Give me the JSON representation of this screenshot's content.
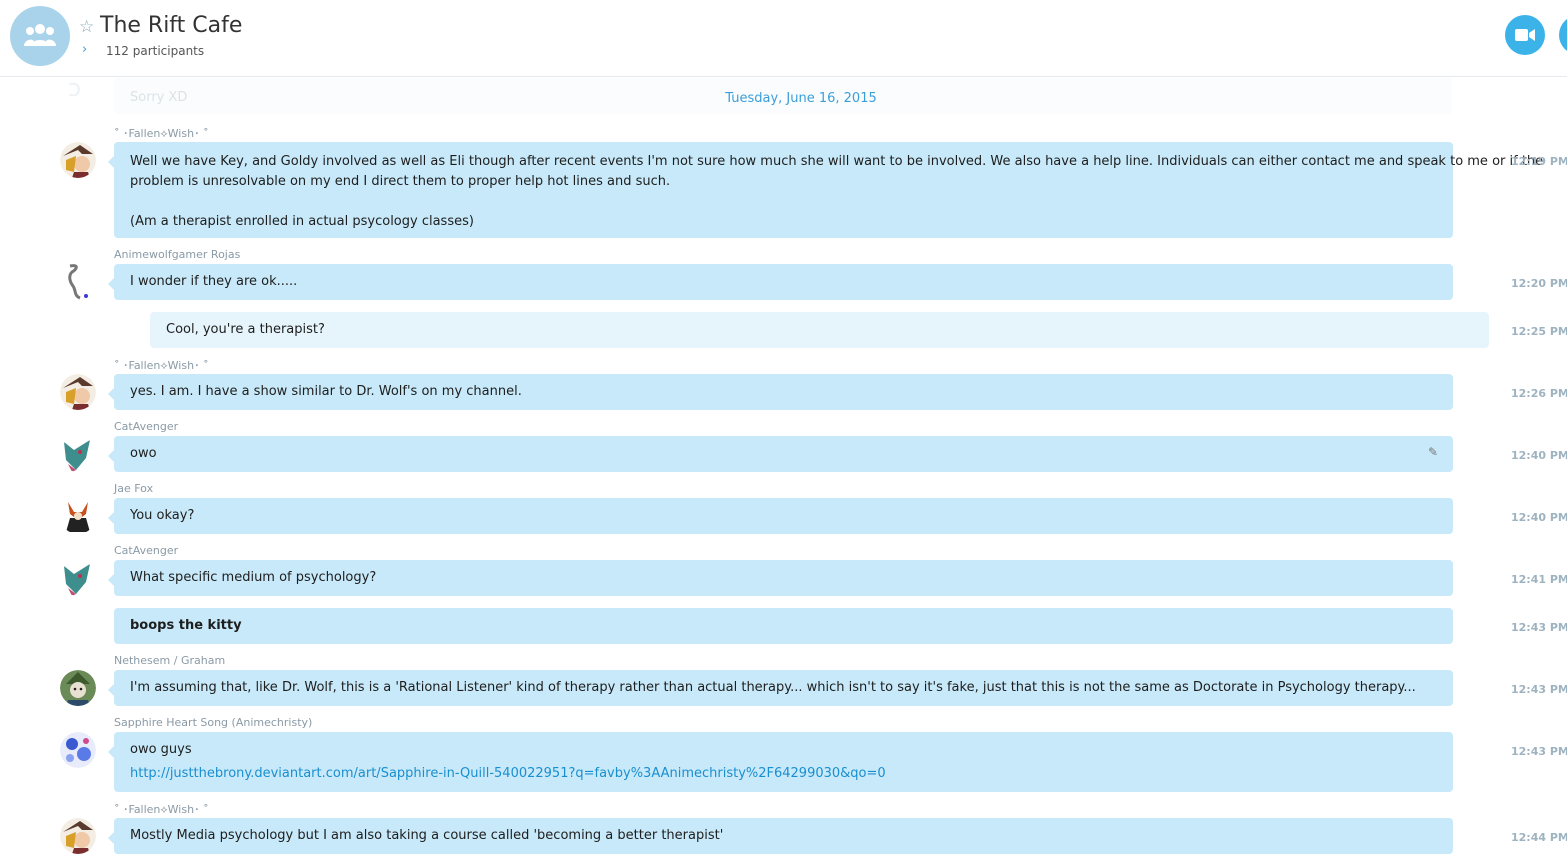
{
  "header": {
    "title": "The Rift Cafe",
    "participants": "112 participants",
    "star_glyph": "☆",
    "chevron_glyph": "›"
  },
  "faded_previous": "Sorry XD",
  "date_separator": "Tuesday, June 16, 2015",
  "messages": [
    {
      "sender": "˚ ･Fallen⟡Wish･ ˚",
      "lines": [
        "Well we have Key, and Goldy involved as well as Eli though after recent events I'm not sure how much she will want to be involved. We also have a help line. Individuals can either contact me and speak to me or if the",
        "problem is unresolvable on my end I direct them to proper help hot lines and such.",
        "",
        "(Am a therapist enrolled in actual psycology classes)"
      ],
      "time": "12:19 PM"
    },
    {
      "sender": "Animewolfgamer Rojas",
      "lines": [
        "I wonder if they are ok....."
      ],
      "time": "12:20 PM"
    },
    {
      "sender": "",
      "lines": [
        "Cool, you're a therapist?"
      ],
      "time": "12:25 PM"
    },
    {
      "sender": "˚ ･Fallen⟡Wish･ ˚",
      "lines": [
        "yes. I am. I have a show similar to Dr. Wolf's on my channel."
      ],
      "time": "12:26 PM"
    },
    {
      "sender": "CatAvenger",
      "lines": [
        "owo"
      ],
      "time": "12:40 PM"
    },
    {
      "sender": "Jae Fox",
      "lines": [
        "You okay?"
      ],
      "time": "12:40 PM"
    },
    {
      "sender": "CatAvenger",
      "lines": [
        "What specific medium of psychology?"
      ],
      "time": "12:41 PM"
    },
    {
      "sender": "",
      "lines": [
        "boops the kitty"
      ],
      "time": "12:43 PM"
    },
    {
      "sender": "Nethesem / Graham",
      "lines": [
        "I'm assuming that, like Dr. Wolf, this is a 'Rational Listener' kind of therapy rather than actual therapy... which isn't to say it's fake, just that this is not the same as Doctorate in Psychology therapy..."
      ],
      "time": "12:43 PM"
    },
    {
      "sender": "Sapphire Heart Song (Animechristy)",
      "lines": [
        "owo guys",
        "http://justthebrony.deviantart.com/art/Sapphire-in-Quill-540022951?q=favby%3AAnimechristy%2F64299030&qo=0"
      ],
      "time": "12:43 PM"
    },
    {
      "sender": "˚ ･Fallen⟡Wish･ ˚",
      "lines": [
        "Mostly Media psychology but I am also taking a course called 'becoming a better therapist'"
      ],
      "time": "12:44 PM"
    }
  ],
  "colors": {
    "accent": "#3bb3e8",
    "bubble": "#c7e9f9",
    "own_bubble": "#e6f5fc",
    "link": "#1a8fd0"
  }
}
